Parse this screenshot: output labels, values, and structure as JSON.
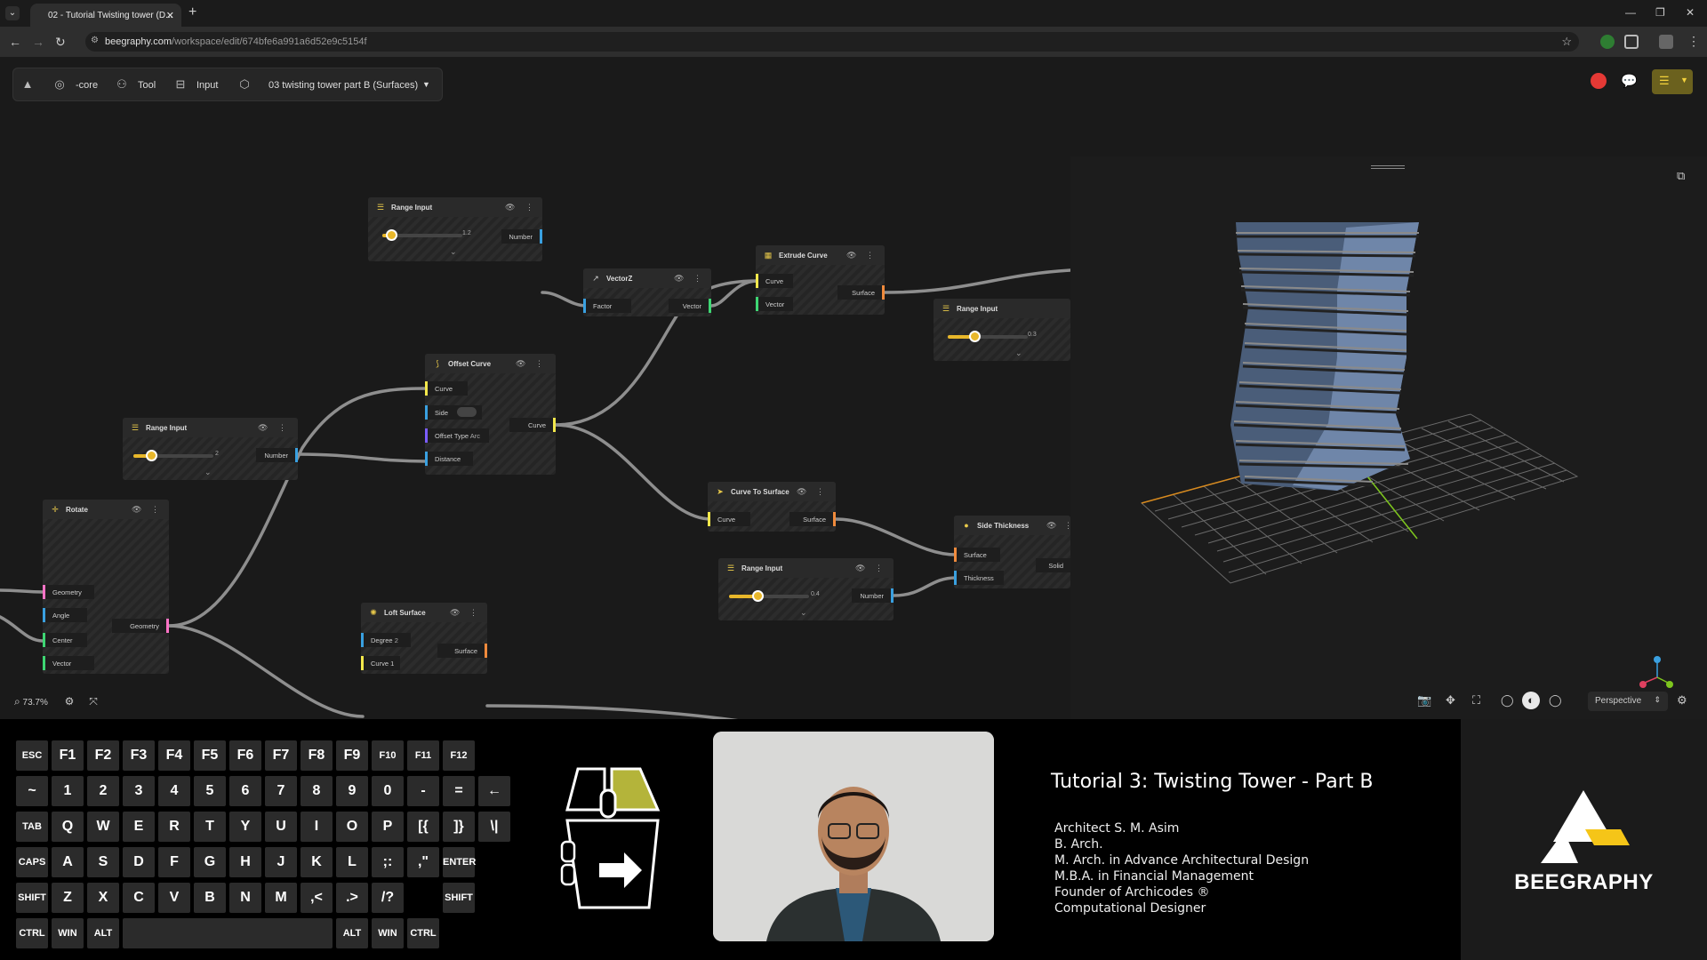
{
  "browser": {
    "tab_title": "02 - Tutorial Twisting tower (D...",
    "url_domain": "beegraphy.com",
    "url_path": "/workspace/edit/674bfe6a991a6d52e9c5154f"
  },
  "toolbar": {
    "core_label": "-core",
    "tool_label": "Tool",
    "input_label": "Input",
    "project_name": "03 twisting tower part B (Surfaces)"
  },
  "nodes": {
    "range_input_1": {
      "title": "Range Input",
      "value": "1.2",
      "output": "Number"
    },
    "vectorz": {
      "title": "VectorZ",
      "input": "Factor",
      "output": "Vector"
    },
    "extrude_curve": {
      "title": "Extrude Curve",
      "input_curve": "Curve",
      "input_vector": "Vector",
      "output": "Surface"
    },
    "range_input_2": {
      "title": "Range Input",
      "value": "0.3"
    },
    "offset_curve": {
      "title": "Offset Curve",
      "input_curve": "Curve",
      "input_side": "Side",
      "input_offset_type": "Offset Type",
      "offset_type_value": "Arc",
      "input_distance": "Distance",
      "output": "Curve"
    },
    "range_input_3": {
      "title": "Range Input",
      "value": "2",
      "output": "Number"
    },
    "curve_to_surface": {
      "title": "Curve To Surface",
      "input": "Curve",
      "output": "Surface"
    },
    "side_thickness": {
      "title": "Side Thickness",
      "input_surface": "Surface",
      "input_thickness": "Thickness",
      "output": "Solid"
    },
    "range_input_4": {
      "title": "Range Input",
      "value": "0.4",
      "output": "Number"
    },
    "rotate": {
      "title": "Rotate",
      "input_geometry": "Geometry",
      "input_angle": "Angle",
      "input_center": "Center",
      "input_vector": "Vector",
      "output": "Geometry"
    },
    "loft_surface": {
      "title": "Loft Surface",
      "input_degree": "Degree",
      "degree_value": "2",
      "input_curve": "Curve 1",
      "output": "Surface"
    }
  },
  "canvas": {
    "zoom": "73.7%"
  },
  "viewport": {
    "camera": "Perspective"
  },
  "keyboard": {
    "rows": [
      [
        "ESC",
        "F1",
        "F2",
        "F3",
        "F4",
        "F5",
        "F6",
        "F7",
        "F8",
        "F9",
        "F10",
        "F11",
        "F12"
      ],
      [
        "~",
        "1",
        "2",
        "3",
        "4",
        "5",
        "6",
        "7",
        "8",
        "9",
        "0",
        "-",
        "=",
        "←"
      ],
      [
        "TAB",
        "Q",
        "W",
        "E",
        "R",
        "T",
        "Y",
        "U",
        "I",
        "O",
        "P",
        "[{",
        "]}",
        "\\|"
      ],
      [
        "CAPS",
        "A",
        "S",
        "D",
        "F",
        "G",
        "H",
        "J",
        "K",
        "L",
        ";:",
        ",\"",
        "ENTER"
      ],
      [
        "SHIFT",
        "Z",
        "X",
        "C",
        "V",
        "B",
        "N",
        "M",
        ",<",
        ".>",
        "/?",
        "SHIFT"
      ],
      [
        "CTRL",
        "WIN",
        "ALT",
        "ALT",
        "WIN",
        "CTRL"
      ]
    ]
  },
  "video": {
    "title": "Tutorial 3: Twisting Tower - Part B",
    "credits": [
      "Architect S. M. Asim",
      "B. Arch.",
      "M. Arch. in Advance Architectural Design",
      "M.B.A. in Financial Management",
      "Founder of Archicodes ®",
      "Computational Designer"
    ],
    "brand": "BEEGRAPHY"
  },
  "colors": {
    "accent": "#e8b72a",
    "brand_yellow": "#f5c518",
    "mouse_highlight": "#b4b43a"
  }
}
